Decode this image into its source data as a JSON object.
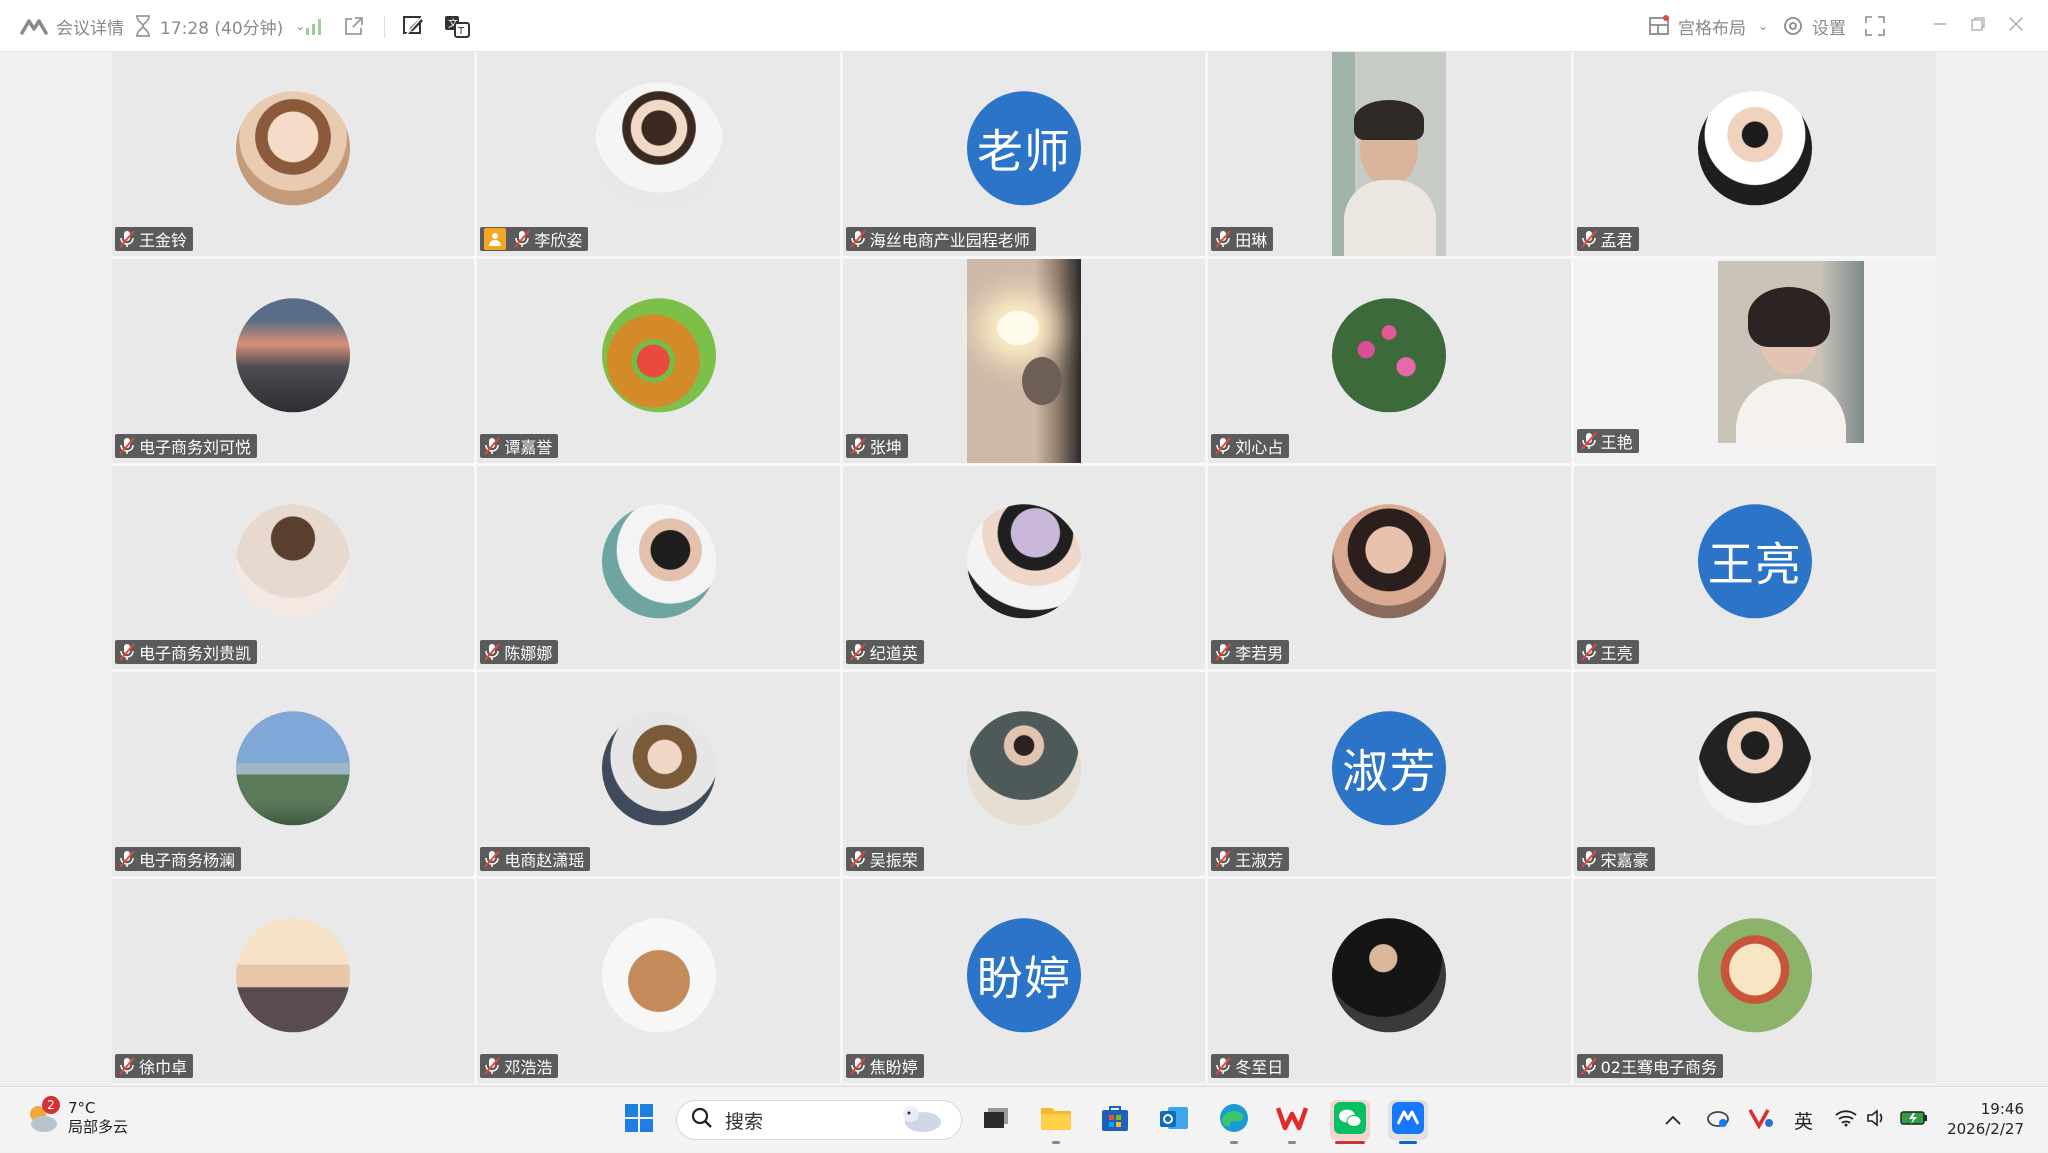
{
  "toolbar": {
    "meeting_details": "会议详情",
    "duration": "17:28 (40分钟)",
    "layout_label": "宫格布局",
    "settings_label": "设置"
  },
  "participants": [
    {
      "name": "王金铃",
      "avatar": "photo"
    },
    {
      "name": "李欣姿",
      "avatar": "photo",
      "host": true
    },
    {
      "name": "海丝电商产业园程老师",
      "avatar": "text",
      "avatar_text": "老师"
    },
    {
      "name": "田琳",
      "avatar": "video"
    },
    {
      "name": "孟君",
      "avatar": "photo"
    },
    {
      "name": "电子商务刘可悦",
      "avatar": "photo"
    },
    {
      "name": "谭嘉誉",
      "avatar": "photo"
    },
    {
      "name": "张坤",
      "avatar": "video"
    },
    {
      "name": "刘心占",
      "avatar": "photo"
    },
    {
      "name": "王艳",
      "avatar": "video"
    },
    {
      "name": "电子商务刘贵凯",
      "avatar": "photo"
    },
    {
      "name": "陈娜娜",
      "avatar": "photo"
    },
    {
      "name": "纪道英",
      "avatar": "photo"
    },
    {
      "name": "李若男",
      "avatar": "photo"
    },
    {
      "name": "王亮",
      "avatar": "text",
      "avatar_text": "王亮"
    },
    {
      "name": "电子商务杨澜",
      "avatar": "photo"
    },
    {
      "name": "电商赵潇瑶",
      "avatar": "photo"
    },
    {
      "name": "吴振荣",
      "avatar": "photo"
    },
    {
      "name": "王淑芳",
      "avatar": "text",
      "avatar_text": "淑芳"
    },
    {
      "name": "宋嘉豪",
      "avatar": "photo"
    },
    {
      "name": "徐巾卓",
      "avatar": "photo"
    },
    {
      "name": "邓浩浩",
      "avatar": "photo"
    },
    {
      "name": "焦盼婷",
      "avatar": "text",
      "avatar_text": "盼婷"
    },
    {
      "name": "冬至日",
      "avatar": "photo"
    },
    {
      "name": "02王骞电子商务",
      "avatar": "photo"
    }
  ],
  "taskbar": {
    "weather_badge": "2",
    "temperature": "7°C",
    "weather_desc": "局部多云",
    "search_placeholder": "搜索",
    "ime_label": "英",
    "time": "19:46",
    "date": "2026/2/27"
  },
  "colors": {
    "text_avatar_bg": "#2b74c8",
    "host_badge": "#f5a623",
    "name_tag_bg": "#3c3c3c"
  }
}
